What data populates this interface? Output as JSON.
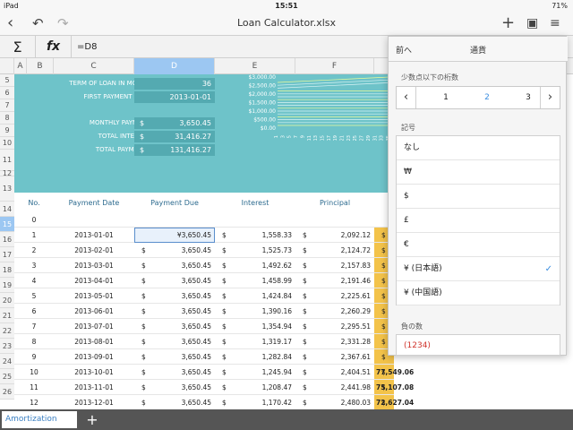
{
  "status": {
    "device": "iPad",
    "wifi": "wifi-icon",
    "time": "15:51",
    "battery": "71%"
  },
  "toolbar": {
    "title": "Loan Calculator.xlsx",
    "back_icon": "chevron-left-icon",
    "undo_icon": "undo-icon",
    "redo_icon": "redo-icon",
    "add_icon": "plus-icon",
    "format_icon": "format-icon",
    "menu_icon": "list-icon"
  },
  "formula": {
    "sigma": "Σ",
    "fx": "fx",
    "text": "=D8"
  },
  "columns": [
    "A",
    "B",
    "C",
    "D",
    "E",
    "F"
  ],
  "rows": [
    "5",
    "6",
    "7",
    "8",
    "9",
    "10",
    "11",
    "12",
    "13",
    "14",
    "15",
    "16",
    "17",
    "18",
    "19",
    "20",
    "21",
    "22",
    "23",
    "24",
    "25",
    "26"
  ],
  "summary": {
    "term_label": "TERM OF LOAN IN MONTH",
    "term_value": "36",
    "first_label": "FIRST PAYMENT DATE",
    "first_value": "2013-01-01",
    "monthly_label": "MONTHLY PAYMENT",
    "monthly_value": "3,650.45",
    "interest_label": "TOTAL INTEREST",
    "interest_value": "31,416.27",
    "payments_label": "TOTAL PAYMENTS",
    "payments_value": "131,416.27",
    "currency": "$"
  },
  "chart_data": {
    "type": "line",
    "y_ticks": [
      "$3,000.00",
      "$2,500.00",
      "$2,000.00",
      "$1,500.00",
      "$1,000.00",
      "$500.00",
      "$0.00"
    ],
    "x_ticks": [
      "1",
      "3",
      "5",
      "7",
      "9",
      "11",
      "13",
      "15",
      "17",
      "19",
      "21",
      "23",
      "25",
      "27",
      "29",
      "31",
      "33",
      "35"
    ]
  },
  "table": {
    "headers": [
      "No.",
      "Payment Date",
      "Payment Due",
      "Interest",
      "Principal"
    ],
    "currency": "$",
    "rows": [
      {
        "no": "0",
        "date": "",
        "due": "",
        "interest": "",
        "principal": "",
        "balance": ""
      },
      {
        "no": "1",
        "date": "2013-01-01",
        "due": "¥3,650.45",
        "interest": "1,558.33",
        "principal": "2,092.12",
        "balance": ""
      },
      {
        "no": "2",
        "date": "2013-02-01",
        "due": "3,650.45",
        "interest": "1,525.73",
        "principal": "2,124.72",
        "balance": ""
      },
      {
        "no": "3",
        "date": "2013-03-01",
        "due": "3,650.45",
        "interest": "1,492.62",
        "principal": "2,157.83",
        "balance": ""
      },
      {
        "no": "4",
        "date": "2013-04-01",
        "due": "3,650.45",
        "interest": "1,458.99",
        "principal": "2,191.46",
        "balance": ""
      },
      {
        "no": "5",
        "date": "2013-05-01",
        "due": "3,650.45",
        "interest": "1,424.84",
        "principal": "2,225.61",
        "balance": ""
      },
      {
        "no": "6",
        "date": "2013-06-01",
        "due": "3,650.45",
        "interest": "1,390.16",
        "principal": "2,260.29",
        "balance": ""
      },
      {
        "no": "7",
        "date": "2013-07-01",
        "due": "3,650.45",
        "interest": "1,354.94",
        "principal": "2,295.51",
        "balance": ""
      },
      {
        "no": "8",
        "date": "2013-08-01",
        "due": "3,650.45",
        "interest": "1,319.17",
        "principal": "2,331.28",
        "balance": ""
      },
      {
        "no": "9",
        "date": "2013-09-01",
        "due": "3,650.45",
        "interest": "1,282.84",
        "principal": "2,367.61",
        "balance": ""
      },
      {
        "no": "10",
        "date": "2013-10-01",
        "due": "3,650.45",
        "interest": "1,245.94",
        "principal": "2,404.51",
        "balance": "77,549.06"
      },
      {
        "no": "11",
        "date": "2013-11-01",
        "due": "3,650.45",
        "interest": "1,208.47",
        "principal": "2,441.98",
        "balance": "75,107.08"
      },
      {
        "no": "12",
        "date": "2013-12-01",
        "due": "3,650.45",
        "interest": "1,170.42",
        "principal": "2,480.03",
        "balance": "72,627.04"
      }
    ]
  },
  "popover": {
    "back": "前へ",
    "title": "通貨",
    "decimals_label": "少数点以下の桁数",
    "decimals": [
      "1",
      "2",
      "3"
    ],
    "selected_decimal": "2",
    "symbol_label": "記号",
    "symbols": [
      "なし",
      "₩",
      "$",
      "£",
      "€",
      "¥ (日本語)",
      "¥ (中国語)"
    ],
    "selected_symbol": "¥ (日本語)",
    "negative_label": "負の数",
    "negative_value": "(1234)"
  },
  "sheet_tab": "Amortization",
  "add_sheet": "+"
}
